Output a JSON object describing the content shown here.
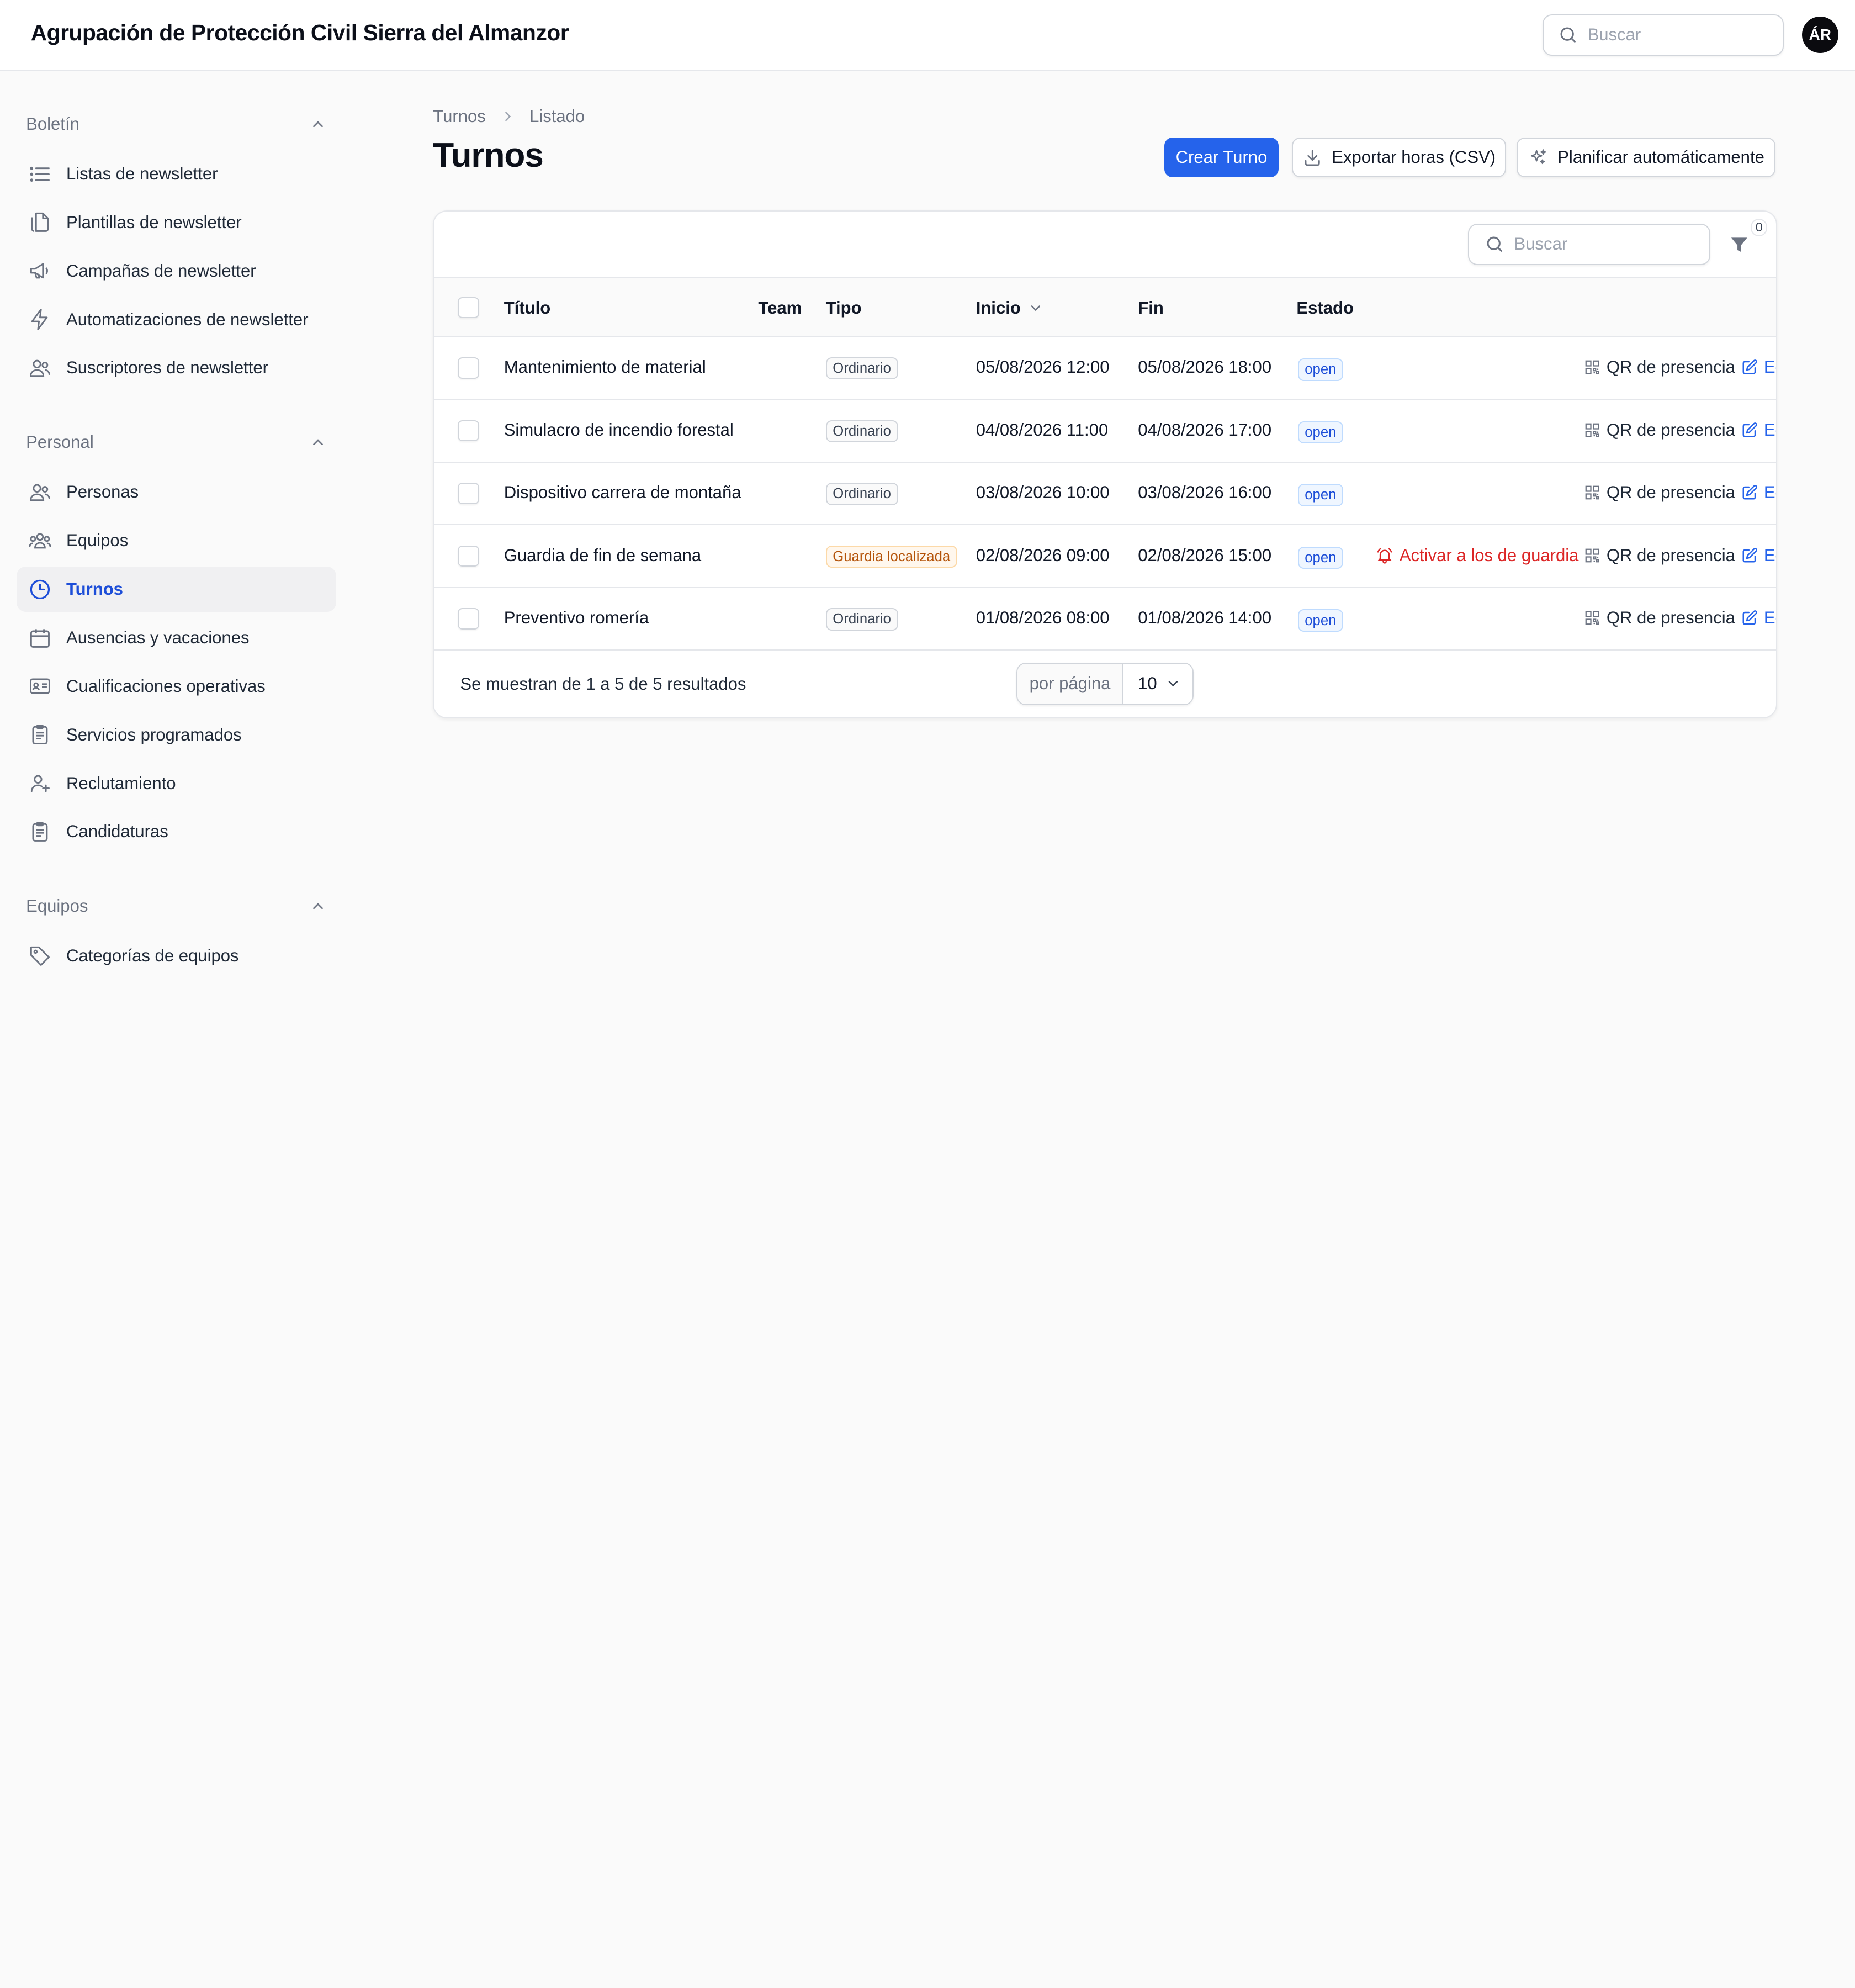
{
  "header": {
    "org_name": "Agrupación de Protección Civil Sierra del Almanzor",
    "search_placeholder": "Buscar",
    "avatar_initials": "ÁR"
  },
  "sidebar": {
    "groups": [
      {
        "label": "Boletín",
        "items": [
          {
            "label": "Listas de newsletter",
            "icon": "list-icon"
          },
          {
            "label": "Plantillas de newsletter",
            "icon": "documents-icon"
          },
          {
            "label": "Campañas de newsletter",
            "icon": "megaphone-icon"
          },
          {
            "label": "Automatizaciones de newsletter",
            "icon": "bolt-icon"
          },
          {
            "label": "Suscriptores de newsletter",
            "icon": "users-icon"
          }
        ]
      },
      {
        "label": "Personal",
        "items": [
          {
            "label": "Personas",
            "icon": "users-icon"
          },
          {
            "label": "Equipos",
            "icon": "user-group-icon"
          },
          {
            "label": "Turnos",
            "icon": "clock-icon",
            "active": true
          },
          {
            "label": "Ausencias y vacaciones",
            "icon": "calendar-icon"
          },
          {
            "label": "Cualificaciones operativas",
            "icon": "id-card-icon"
          },
          {
            "label": "Servicios programados",
            "icon": "clipboard-icon"
          },
          {
            "label": "Reclutamiento",
            "icon": "user-plus-icon"
          },
          {
            "label": "Candidaturas",
            "icon": "clipboard-icon"
          }
        ]
      },
      {
        "label": "Equipos",
        "items": [
          {
            "label": "Categorías de equipos",
            "icon": "tag-icon"
          }
        ]
      }
    ]
  },
  "breadcrumb": [
    "Turnos",
    "Listado"
  ],
  "page_title": "Turnos",
  "actions": {
    "create": "Crear Turno",
    "export": "Exportar horas (CSV)",
    "plan": "Planificar automáticamente"
  },
  "table": {
    "search_placeholder": "Buscar",
    "filter_count": "0",
    "columns": {
      "title": "Título",
      "team": "Team",
      "type": "Tipo",
      "start": "Inicio",
      "end": "Fin",
      "status": "Estado"
    },
    "rows": [
      {
        "title": "Mantenimiento de material",
        "type": "Ordinario",
        "type_variant": "neutral",
        "start": "05/08/2026 12:00",
        "end": "05/08/2026 18:00",
        "status": "open",
        "alert": ""
      },
      {
        "title": "Simulacro de incendio forestal",
        "type": "Ordinario",
        "type_variant": "neutral",
        "start": "04/08/2026 11:00",
        "end": "04/08/2026 17:00",
        "status": "open",
        "alert": ""
      },
      {
        "title": "Dispositivo carrera de montaña",
        "type": "Ordinario",
        "type_variant": "neutral",
        "start": "03/08/2026 10:00",
        "end": "03/08/2026 16:00",
        "status": "open",
        "alert": ""
      },
      {
        "title": "Guardia de fin de semana",
        "type": "Guardia localizada",
        "type_variant": "warning",
        "start": "02/08/2026 09:00",
        "end": "02/08/2026 15:00",
        "status": "open",
        "alert": "Activar a los de guardia"
      },
      {
        "title": "Preventivo romería",
        "type": "Ordinario",
        "type_variant": "neutral",
        "start": "01/08/2026 08:00",
        "end": "01/08/2026 14:00",
        "status": "open",
        "alert": ""
      }
    ],
    "row_actions": {
      "qr": "QR de presencia",
      "edit": "Ec"
    },
    "footer_text": "Se muestran de 1 a 5 de 5 resultados",
    "per_page_label": "por página",
    "per_page_value": "10"
  },
  "colors": {
    "primary": "#2563eb",
    "danger": "#dc2626",
    "active_bg": "#f0f0f2"
  }
}
